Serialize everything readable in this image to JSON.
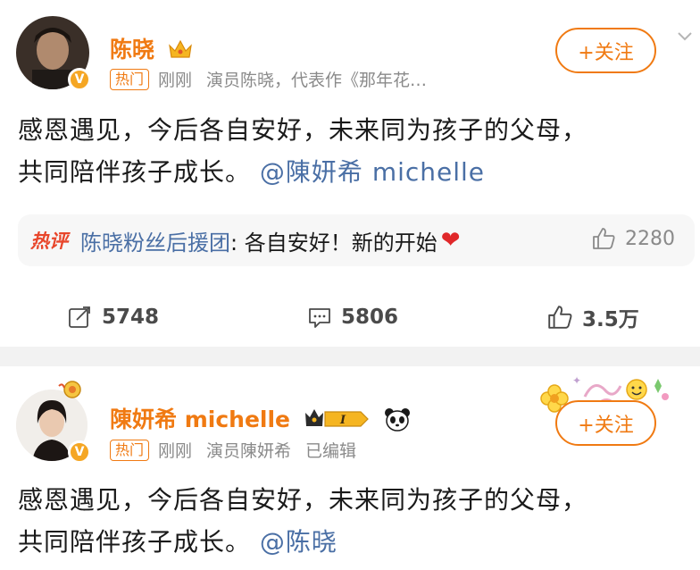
{
  "post1": {
    "author": "陈晓",
    "hot_tag": "热门",
    "time": "刚刚",
    "bio": "演员陈晓，代表作《那年花…",
    "follow_label": "+关注",
    "body_line1": "感恩遇见，今后各自安好，未来同为孩子的父母，",
    "body_line2": "共同陪伴孩子成长。",
    "mention": "@陳妍希 michelle",
    "hot_comment": {
      "label": "热评",
      "user": "陈晓粉丝后援团",
      "text": ": 各自安好！新的开始",
      "likes": "2280"
    },
    "actions": {
      "reposts": "5748",
      "comments": "5806",
      "likes": "3.5万"
    }
  },
  "post2": {
    "author": "陳妍希 michelle",
    "hot_tag": "热门",
    "time": "刚刚",
    "bio": "演员陳妍希",
    "edited": "已编辑",
    "follow_label": "+关注",
    "body_line1": "感恩遇见，今后各自安好，未来同为孩子的父母，",
    "body_line2": "共同陪伴孩子成长。",
    "mention": "@陈晓"
  },
  "colors": {
    "accent": "#f07a12",
    "link": "#4a6fa5",
    "hot_red": "#e8462b"
  }
}
